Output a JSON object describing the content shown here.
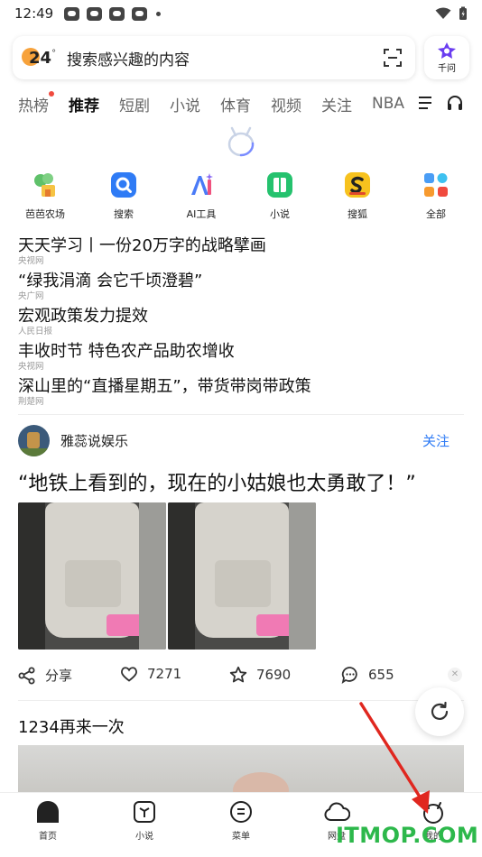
{
  "status_bar": {
    "time": "12:49"
  },
  "search": {
    "weather_temp": "24",
    "weather_deg": "°",
    "placeholder": "搜索感兴趣的内容",
    "qianwen_label": "千问"
  },
  "tabs": [
    {
      "label": "热榜"
    },
    {
      "label": "推荐"
    },
    {
      "label": "短剧"
    },
    {
      "label": "小说"
    },
    {
      "label": "体育"
    },
    {
      "label": "视频"
    },
    {
      "label": "关注"
    },
    {
      "label": "NBA"
    }
  ],
  "apps": [
    {
      "label": "芭芭农场",
      "icon": "farm-icon"
    },
    {
      "label": "搜索",
      "icon": "search-icon"
    },
    {
      "label": "AI工具",
      "icon": "ai-tools-icon"
    },
    {
      "label": "小说",
      "icon": "novel-icon"
    },
    {
      "label": "搜狐",
      "icon": "sohu-icon"
    },
    {
      "label": "全部",
      "icon": "all-apps-icon"
    }
  ],
  "hot_news": [
    {
      "title": "天天学习丨一份20万字的战略擘画",
      "source": "央视网"
    },
    {
      "title": "“绿我涓滴 会它千顷澄碧”",
      "source": "央广网"
    },
    {
      "title": "宏观政策发力提效",
      "source": "人民日报"
    },
    {
      "title": "丰收时节 特色农产品助农增收",
      "source": "央视网"
    },
    {
      "title": "深山里的“直播星期五”，带货带岗带政策",
      "source": "荆楚网"
    }
  ],
  "post": {
    "author": "雅蕊说娱乐",
    "follow_label": "关注",
    "title": "“地铁上看到的，现在的小姑娘也太勇敢了！”",
    "share_label": "分享",
    "likes": "7271",
    "favorites": "7690",
    "comments": "655"
  },
  "next_post": {
    "title": "1234再来一次"
  },
  "bottom_nav": [
    {
      "label": "首页"
    },
    {
      "label": "小说"
    },
    {
      "label": "菜单"
    },
    {
      "label": "网盘"
    },
    {
      "label": "我的"
    }
  ],
  "watermark": "ITMOP.COM",
  "colors": {
    "accent": "#2f7bf5",
    "red_dot": "#f04a3e",
    "watermark": "#2db84b",
    "annotation_arrow": "#e0271f"
  }
}
